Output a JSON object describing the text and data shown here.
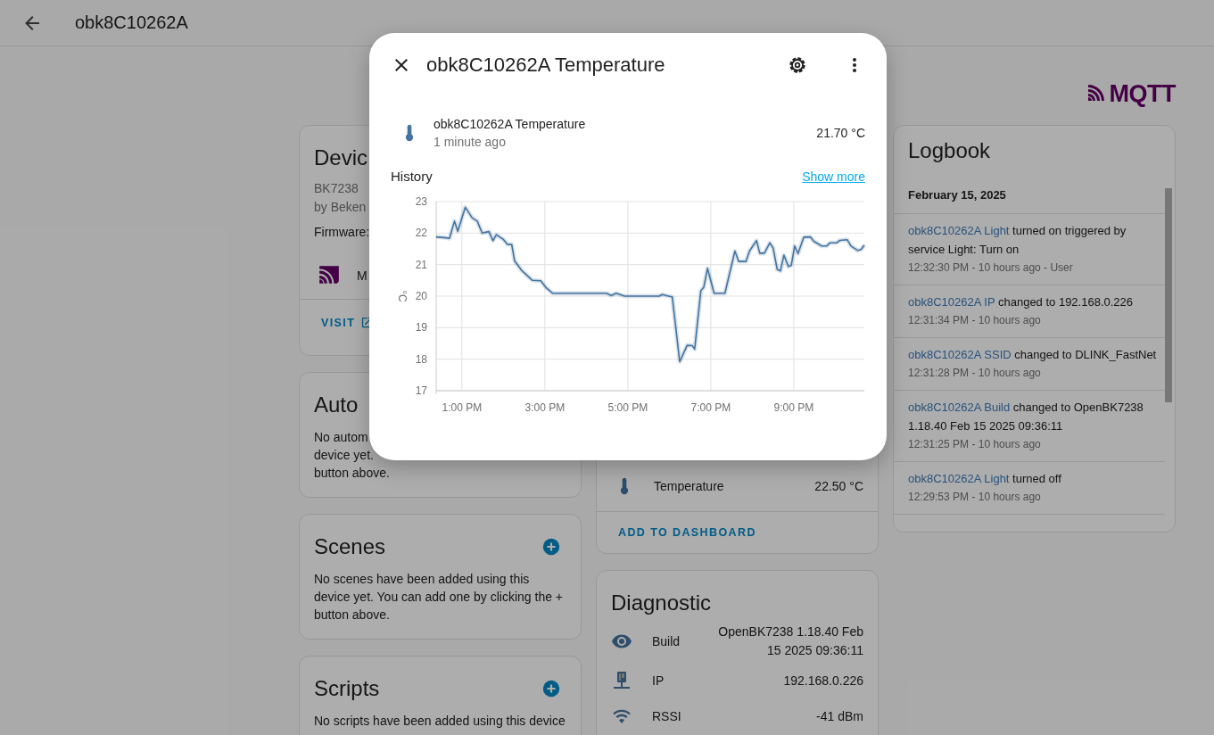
{
  "header": {
    "title": "obk8C10262A"
  },
  "device_card": {
    "title": "Devic",
    "model": "BK7238",
    "manufacturer": "by Beken",
    "firmware_label": "Firmware:",
    "integration": "M",
    "visit": "VISIT"
  },
  "automations_card": {
    "title": "Auto",
    "lines": [
      "No autom",
      "device yet.",
      "button above."
    ]
  },
  "scenes_card": {
    "title": "Scenes",
    "description": "No scenes have been added using this device yet. You can add one by clicking the + button above."
  },
  "scripts_card": {
    "title": "Scripts",
    "description": "No scripts have been added using this device"
  },
  "sensors_card": {
    "rows": [
      {
        "name": "Temperature",
        "value": "22.50 °C"
      }
    ],
    "action": "ADD TO DASHBOARD"
  },
  "diagnostic_card": {
    "title": "Diagnostic",
    "rows": [
      {
        "name": "Build",
        "value": "OpenBK7238 1.18.40 Feb 15 2025 09:36:11"
      },
      {
        "name": "IP",
        "value": "192.168.0.226"
      },
      {
        "name": "RSSI",
        "value": "-41 dBm"
      }
    ]
  },
  "integration_logo": {
    "text": "MQTT"
  },
  "logbook": {
    "title": "Logbook",
    "date": "February 15, 2025",
    "entries": [
      {
        "entity": "obk8C10262A Light",
        "message": "turned on triggered by service Light: Turn on",
        "time": "12:32:30 PM - 10 hours ago - User"
      },
      {
        "entity": "obk8C10262A IP",
        "message": "changed to 192.168.0.226",
        "time": "12:31:34 PM - 10 hours ago"
      },
      {
        "entity": "obk8C10262A SSID",
        "message": "changed to DLINK_FastNet",
        "time": "12:31:28 PM - 10 hours ago"
      },
      {
        "entity": "obk8C10262A Build",
        "message": "changed to OpenBK7238 1.18.40 Feb 15 2025 09:36:11",
        "time": "12:31:25 PM - 10 hours ago"
      },
      {
        "entity": "obk8C10262A Light",
        "message": "turned off",
        "time": "12:29:53 PM - 10 hours ago"
      }
    ]
  },
  "dialog": {
    "title": "obk8C10262A Temperature",
    "entity_name": "obk8C10262A Temperature",
    "last_changed": "1 minute ago",
    "state": "21.70 °C",
    "history_title": "History",
    "show_more": "Show more",
    "chart_data": {
      "type": "line",
      "grid": true,
      "ylabel": "°C",
      "ylim": [
        17,
        23
      ],
      "xlim": [
        12.38,
        22.7
      ],
      "yticks": [
        17,
        18,
        19,
        20,
        21,
        22,
        23
      ],
      "xticks": [
        {
          "value": 13,
          "label": "1:00 PM"
        },
        {
          "value": 15,
          "label": "3:00 PM"
        },
        {
          "value": 17,
          "label": "5:00 PM"
        },
        {
          "value": 19,
          "label": "7:00 PM"
        },
        {
          "value": 21,
          "label": "9:00 PM"
        }
      ],
      "x": [
        12.38,
        12.62,
        12.7,
        12.82,
        12.9,
        13.08,
        13.25,
        13.37,
        13.49,
        13.65,
        13.75,
        13.83,
        14.0,
        14.1,
        14.2,
        14.27,
        14.45,
        14.7,
        14.9,
        15.02,
        15.19,
        16.48,
        16.6,
        16.72,
        16.92,
        17.75,
        17.83,
        18.07,
        18.25,
        18.43,
        18.55,
        18.61,
        18.76,
        18.83,
        18.92,
        19.08,
        19.34,
        19.58,
        19.67,
        19.85,
        19.93,
        20.1,
        20.18,
        20.29,
        20.42,
        20.5,
        20.6,
        20.68,
        20.76,
        20.87,
        20.94,
        21.02,
        21.1,
        21.24,
        21.4,
        21.48,
        21.67,
        21.79,
        21.87,
        22.03,
        22.11,
        22.29,
        22.38,
        22.54,
        22.62,
        22.7
      ],
      "series": [
        {
          "color": "#44739e",
          "values": [
            21.88,
            21.85,
            21.83,
            22.38,
            22.06,
            22.82,
            22.48,
            22.38,
            22.0,
            22.05,
            21.76,
            21.95,
            21.8,
            21.64,
            21.64,
            21.12,
            20.8,
            20.5,
            20.49,
            20.28,
            20.09,
            20.09,
            20.02,
            20.09,
            20.0,
            20.0,
            20.05,
            19.97,
            17.92,
            18.44,
            18.43,
            18.32,
            20.17,
            20.28,
            20.88,
            20.09,
            20.09,
            21.43,
            21.1,
            21.1,
            21.43,
            21.76,
            21.36,
            21.36,
            21.69,
            21.53,
            20.85,
            20.8,
            21.3,
            20.94,
            20.98,
            21.59,
            21.35,
            21.87,
            21.88,
            21.74,
            21.59,
            21.59,
            21.69,
            21.69,
            21.77,
            21.79,
            21.59,
            21.45,
            21.48,
            21.62
          ]
        }
      ]
    }
  }
}
